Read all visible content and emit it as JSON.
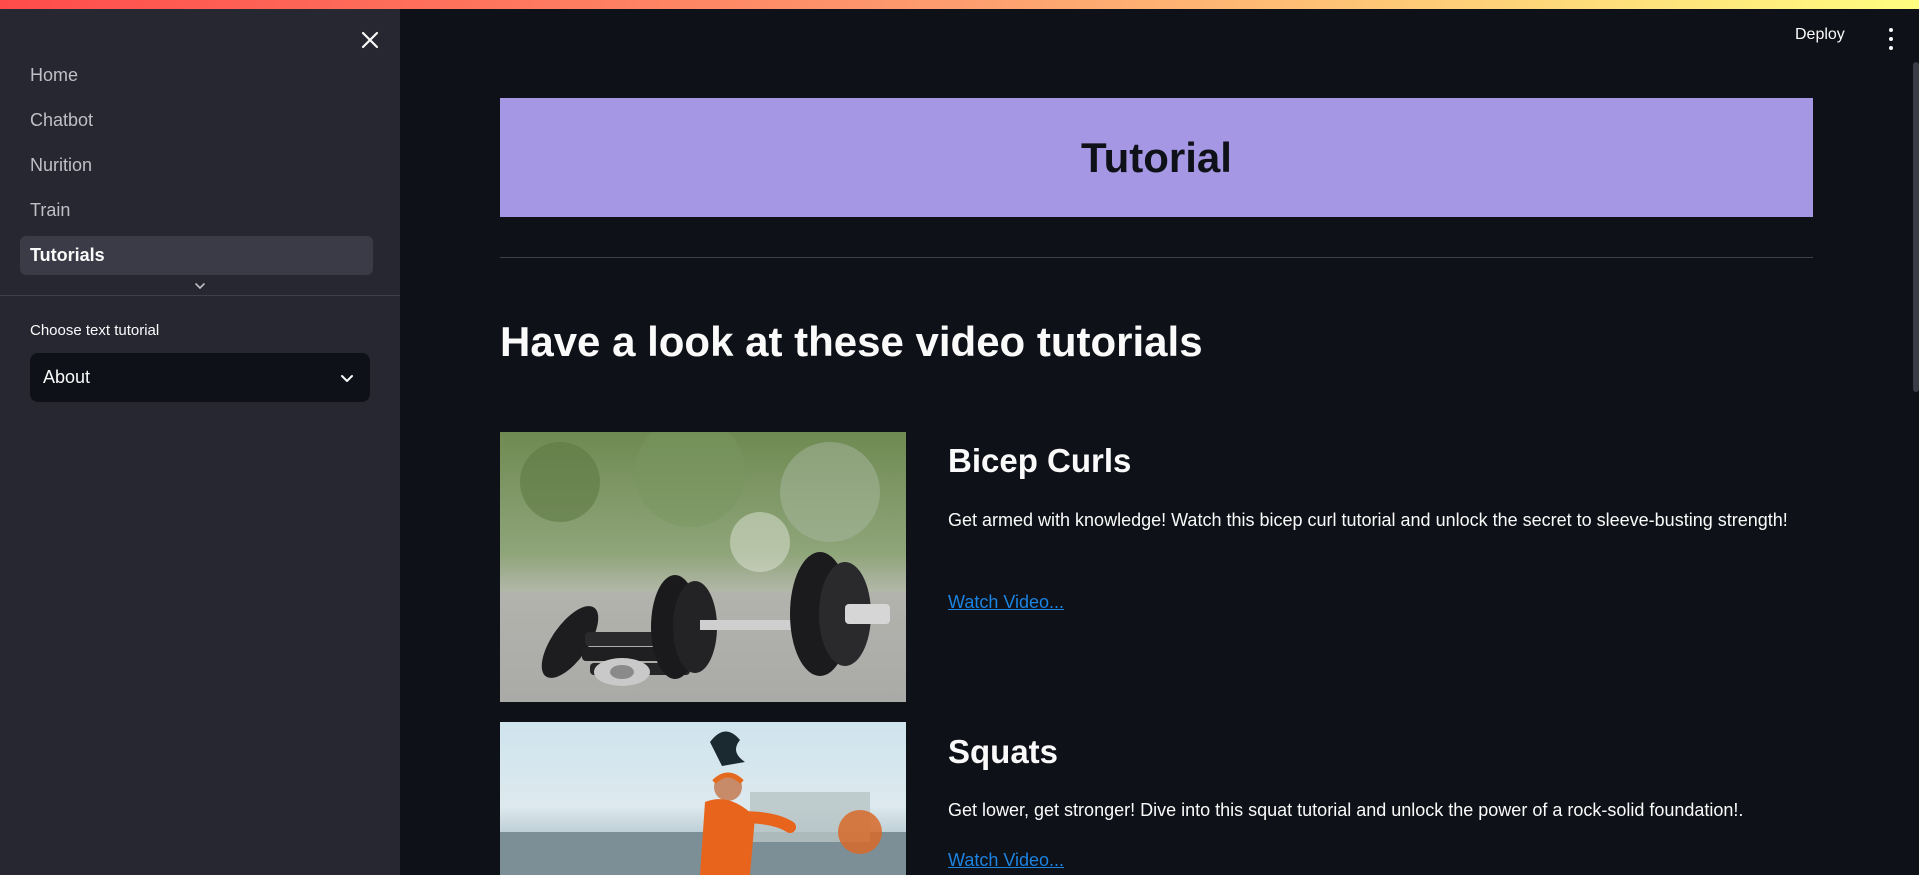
{
  "sidebar": {
    "close_icon": "close-icon",
    "nav": [
      {
        "label": "Home"
      },
      {
        "label": "Chatbot"
      },
      {
        "label": "Nurition"
      },
      {
        "label": "Train"
      },
      {
        "label": "Tutorials"
      }
    ],
    "active_item": "Tutorials",
    "expand_icon": "chevron-down-icon",
    "select": {
      "label": "Choose text tutorial",
      "value": "About",
      "icon": "chevron-down-icon"
    }
  },
  "header": {
    "deploy_label": "Deploy",
    "menu_icon": "kebab-menu-icon"
  },
  "main": {
    "banner_title": "Tutorial",
    "section_title": "Have a look at these video tutorials",
    "tutorials": [
      {
        "title": "Bicep Curls",
        "description": "Get armed with knowledge! Watch this bicep curl tutorial and unlock the secret to sleeve-busting strength!",
        "link_label": "Watch Video..."
      },
      {
        "title": "Squats",
        "description": "Get lower, get stronger! Dive into this squat tutorial and unlock the power of a rock-solid foundation!.",
        "link_label": "Watch Video..."
      }
    ]
  },
  "colors": {
    "background": "#0e1117",
    "sidebar": "#262730",
    "banner": "#a597e3",
    "link": "#1c83e1",
    "active_nav": "#3a3b46"
  }
}
